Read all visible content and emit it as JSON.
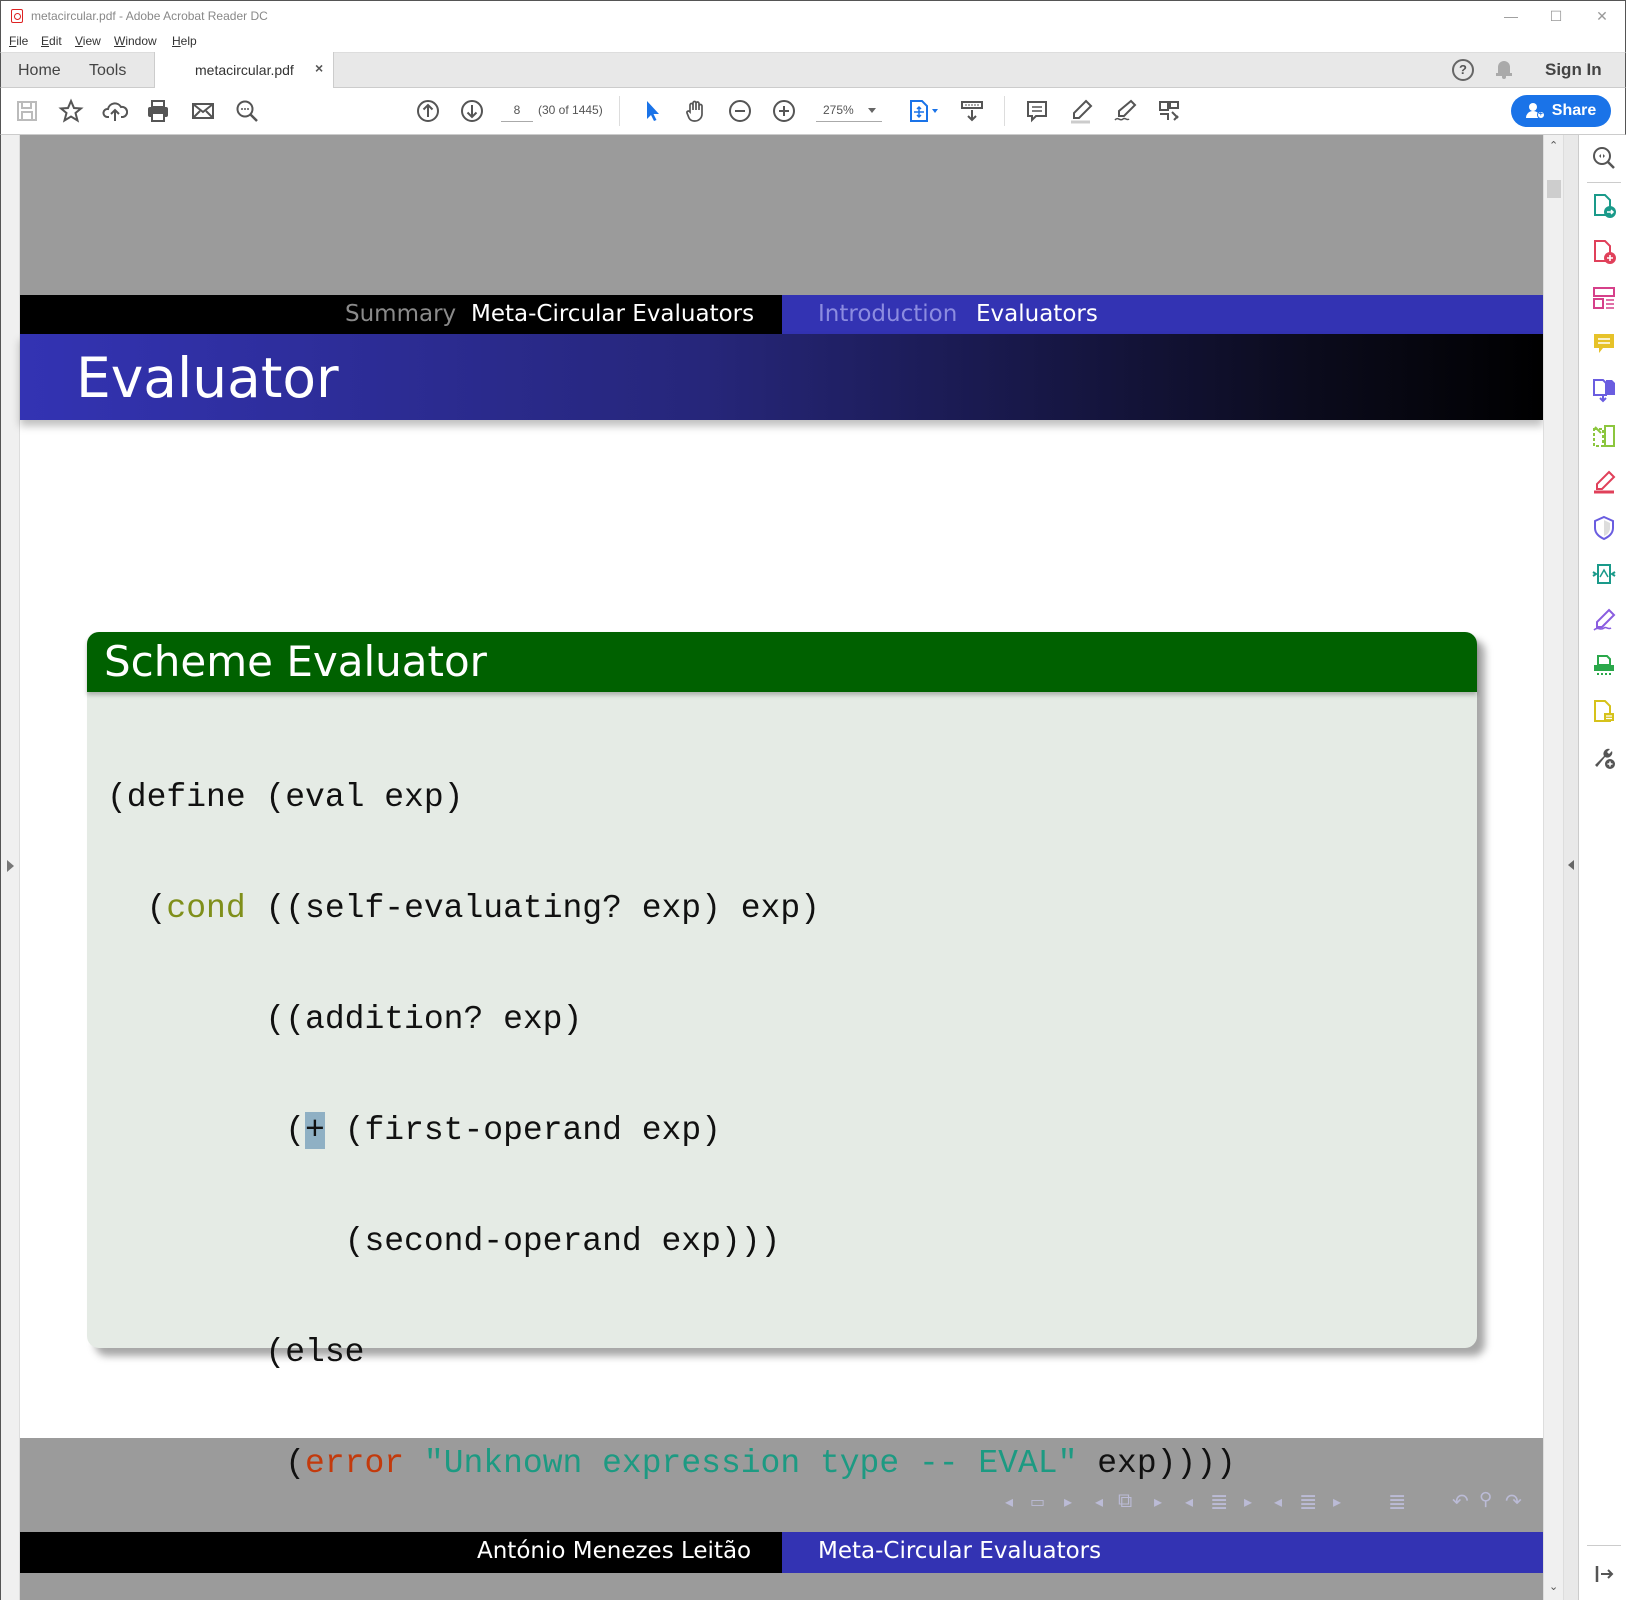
{
  "window": {
    "title": "metacircular.pdf - Adobe Acrobat Reader DC",
    "controls": {
      "minimize": "—",
      "maximize": "☐",
      "close": "✕"
    }
  },
  "menu": {
    "items": [
      {
        "label": "File",
        "accel": "F",
        "rest": "ile"
      },
      {
        "label": "Edit",
        "accel": "E",
        "rest": "dit"
      },
      {
        "label": "View",
        "accel": "V",
        "rest": "iew"
      },
      {
        "label": "Window",
        "accel": "W",
        "rest": "indow"
      },
      {
        "label": "Help",
        "accel": "H",
        "rest": "elp"
      }
    ]
  },
  "tabs": {
    "home": "Home",
    "tools": "Tools",
    "document": "metacircular.pdf",
    "close": "×",
    "help": "?",
    "sign_in": "Sign In"
  },
  "toolbar": {
    "page_number": "8",
    "page_count": "(30 of 1445)",
    "zoom_level": "275%",
    "share_label": "Share"
  },
  "icons": {
    "toolbar_left": [
      "save-icon",
      "bookmark-star-icon",
      "cloud-upload-icon",
      "print-icon",
      "email-icon",
      "find-text-icon"
    ],
    "toolbar_nav": [
      "previous-page-icon",
      "next-page-icon"
    ],
    "toolbar_tools": [
      "select-cursor-icon",
      "hand-tool-icon",
      "zoom-out-icon",
      "zoom-in-icon",
      "fit-page-icon",
      "scroll-mode-icon",
      "comment-icon",
      "highlight-icon",
      "sign-icon",
      "more-tools-icon"
    ],
    "right_pane": [
      "search-zoom-icon",
      "export-pdf-icon",
      "create-pdf-icon",
      "edit-pdf-icon",
      "comment-icon",
      "combine-files-icon",
      "organize-pages-icon",
      "fill-sign-icon",
      "protect-icon",
      "send-for-review-icon",
      "certificate-sign-icon",
      "scan-icon",
      "send-file-icon",
      "more-tools-icon",
      "collapse-pane-icon"
    ]
  },
  "slide": {
    "headline": {
      "section_inactive": "Summary",
      "section_active": "Meta-Circular Evaluators",
      "subsection_inactive": "Introduction",
      "subsection_active": "Evaluators"
    },
    "frame_title": "Evaluator",
    "block_title": "Scheme Evaluator",
    "code": {
      "l1": "(define (eval exp)",
      "l2_a": "  (",
      "l2_kw": "cond",
      "l2_b": " ((self-evaluating? exp) exp)",
      "l3": "        ((addition? exp)",
      "l4_a": "         (",
      "l4_sel": "+",
      "l4_b": " (first-operand exp)",
      "l5": "            (second-operand exp)))",
      "l6": "        (else",
      "l7_a": "         (",
      "l7_err": "error",
      "l7_sp": " ",
      "l7_str": "\"Unknown expression type -- EVAL\"",
      "l7_b": " exp))))"
    },
    "footline": {
      "author": "António Menezes Leitão",
      "title": "Meta-Circular Evaluators"
    },
    "nav_symbols": {
      "frame_prev": "◂",
      "frame": "▭",
      "frame_next": "▸",
      "sub_prev": "◂",
      "sub": "⧉",
      "sub_next": "▸",
      "sec_prev": "◂",
      "sec": "≣",
      "sec_next": "▸",
      "doc_prev": "◂",
      "doc": "≣",
      "doc_next": "▸",
      "toc": "≣",
      "back": "↶",
      "search": "⚲",
      "forward": "↷"
    }
  },
  "colors": {
    "accent_blue": "#1a73e8",
    "beamer_blue": "#3333b3",
    "block_green": "#006100",
    "block_bg": "#e5ebe5",
    "keyword": "#7f8f1a",
    "error_fn": "#c33a0c",
    "string": "#1d9a82"
  }
}
